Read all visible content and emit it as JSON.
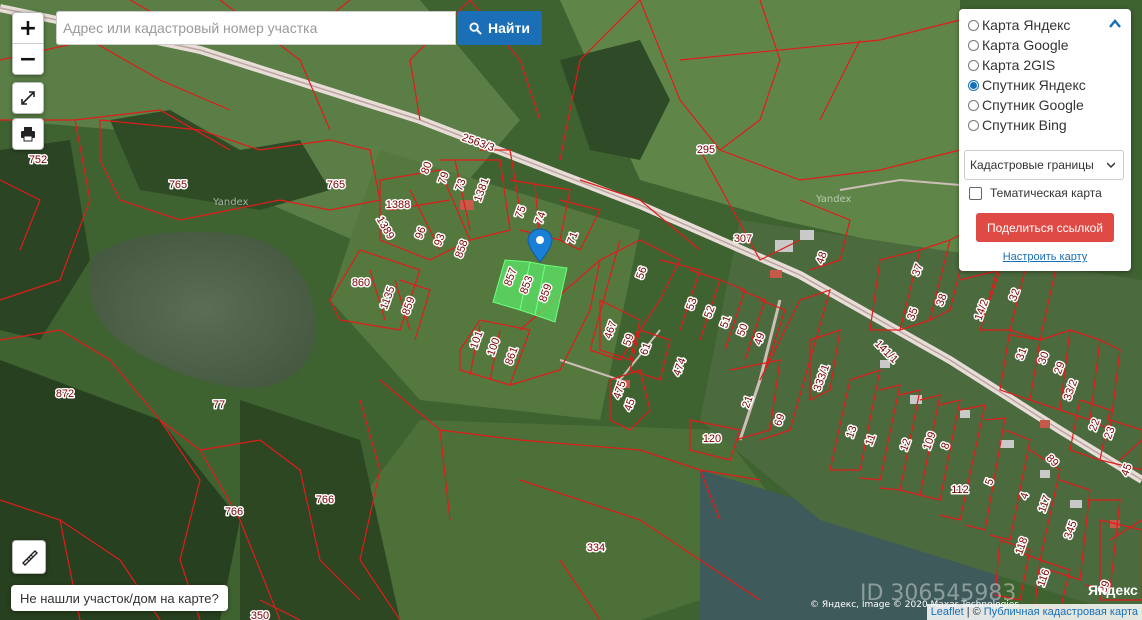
{
  "search": {
    "placeholder": "Адрес или кадастровый номер участка",
    "button_label": "Найти"
  },
  "zoom": {
    "in_label": "+",
    "out_label": "−"
  },
  "layers": {
    "base_maps": [
      {
        "label": "Карта Яндекс",
        "selected": false
      },
      {
        "label": "Карта Google",
        "selected": false
      },
      {
        "label": "Карта 2GIS",
        "selected": false
      },
      {
        "label": "Спутник Яндекс",
        "selected": true
      },
      {
        "label": "Спутник Google",
        "selected": false
      },
      {
        "label": "Спутник Bing",
        "selected": false
      }
    ],
    "overlay_select": "Кадастровые границы",
    "thematic_label": "Тематическая карта",
    "share_button": "Поделиться ссылкой",
    "setup_link": "Настроить карту"
  },
  "not_found_button": "Не нашли участок/дом на карте?",
  "attribution": {
    "leaflet": "Leaflet",
    "separator": "| ©",
    "pkk": "Публичная кадастровая карта",
    "yandex": "© Яндекс, Image © 2020 Maxar Technologies"
  },
  "watermarks": {
    "yandex_1": "Yandex",
    "yandex_2": "Yandex",
    "logo": "Яндекс",
    "cian_id": "ID 306545983"
  },
  "plot_labels": [
    "752",
    "765",
    "765",
    "80",
    "79",
    "73",
    "1381",
    "2563/3",
    "295",
    "1388",
    "1389",
    "96",
    "93",
    "858",
    "75",
    "74",
    "71",
    "857",
    "853",
    "859",
    "860",
    "1135",
    "859",
    "101",
    "100",
    "861",
    "307",
    "56",
    "53",
    "52",
    "51",
    "50",
    "49",
    "48",
    "467",
    "59",
    "61",
    "474",
    "475",
    "45",
    "21",
    "69",
    "120",
    "333/1",
    "141/1",
    "13",
    "11",
    "12",
    "109",
    "8",
    "112",
    "5",
    "4",
    "117",
    "118",
    "116",
    "345",
    "39",
    "37",
    "38",
    "35",
    "14/2",
    "32",
    "31",
    "30",
    "29",
    "33/2",
    "89",
    "22",
    "23",
    "872",
    "77",
    "766",
    "766",
    "334",
    "350",
    "45"
  ],
  "colors": {
    "boundary": "#e31b1b",
    "selected_plot": "#5ce86a",
    "marker": "#1a7fd6",
    "road": "#d9c8c0"
  }
}
